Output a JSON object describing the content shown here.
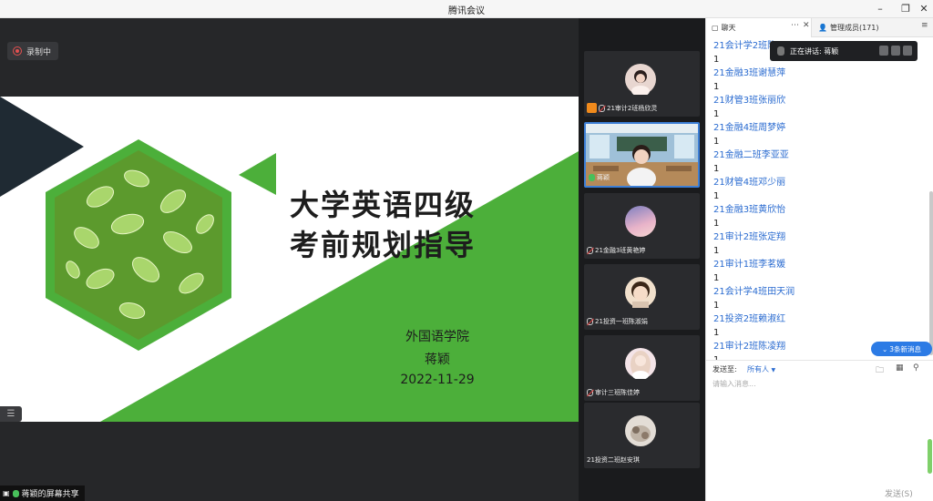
{
  "window": {
    "title": "腾讯会议"
  },
  "stage": {
    "recording_label": "录制中",
    "share_label": "蒋颖的屏幕共享"
  },
  "slide": {
    "title_line1": "大学英语四级",
    "title_line2": "考前规划指导",
    "department": "外国语学院",
    "presenter": "蒋颖",
    "date": "2022-11-29",
    "colors": {
      "green": "#4caf3a",
      "dark": "#1f2a33"
    }
  },
  "participants": [
    {
      "name": "21审计2班杨欣灵",
      "avatar": "photo-girl-icon",
      "host": true,
      "mic": "muted"
    },
    {
      "name": "蒋颖",
      "avatar": "classroom-video",
      "host": false,
      "mic": "active"
    },
    {
      "name": "21金融3班黄艳婷",
      "avatar": "sky-icon",
      "host": false,
      "mic": "muted"
    },
    {
      "name": "21投资一班陈淑娟",
      "avatar": "child-icon",
      "host": false,
      "mic": "muted"
    },
    {
      "name": "审计三班陈佳婷",
      "avatar": "girl-icon",
      "host": false,
      "mic": "muted"
    },
    {
      "name": "21投资二班赵安琪",
      "avatar": "cat-icon",
      "host": false,
      "mic": "none"
    }
  ],
  "chat": {
    "tab_chat": "聊天",
    "tab_members": "管理成员(171)",
    "speaking_label": "正在讲话: 蒋颖",
    "messages": [
      {
        "name": "21会计学2班陈",
        "text": "1"
      },
      {
        "name": "21金融3班谢慧萍",
        "text": "1"
      },
      {
        "name": "21财管3班张丽欣",
        "text": "1"
      },
      {
        "name": "21金融4班周梦婷",
        "text": "1"
      },
      {
        "name": "21金融二班李亚亚",
        "text": "1"
      },
      {
        "name": "21财管4班邓少丽",
        "text": "1"
      },
      {
        "name": "21金融3班黄欣怡",
        "text": "1"
      },
      {
        "name": "21审计2班张定翔",
        "text": "1"
      },
      {
        "name": "21审计1班李茗媛",
        "text": "1"
      },
      {
        "name": "21会计学4班田天润",
        "text": "1"
      },
      {
        "name": "21投资2班赖淑红",
        "text": "1"
      },
      {
        "name": "21审计2班陈凌翔",
        "text": "1"
      }
    ],
    "new_messages": "3条新消息",
    "send_to_label": "发送至:",
    "send_to_value": "所有人",
    "input_placeholder": "请输入消息...",
    "send_button": "发送(S)"
  }
}
